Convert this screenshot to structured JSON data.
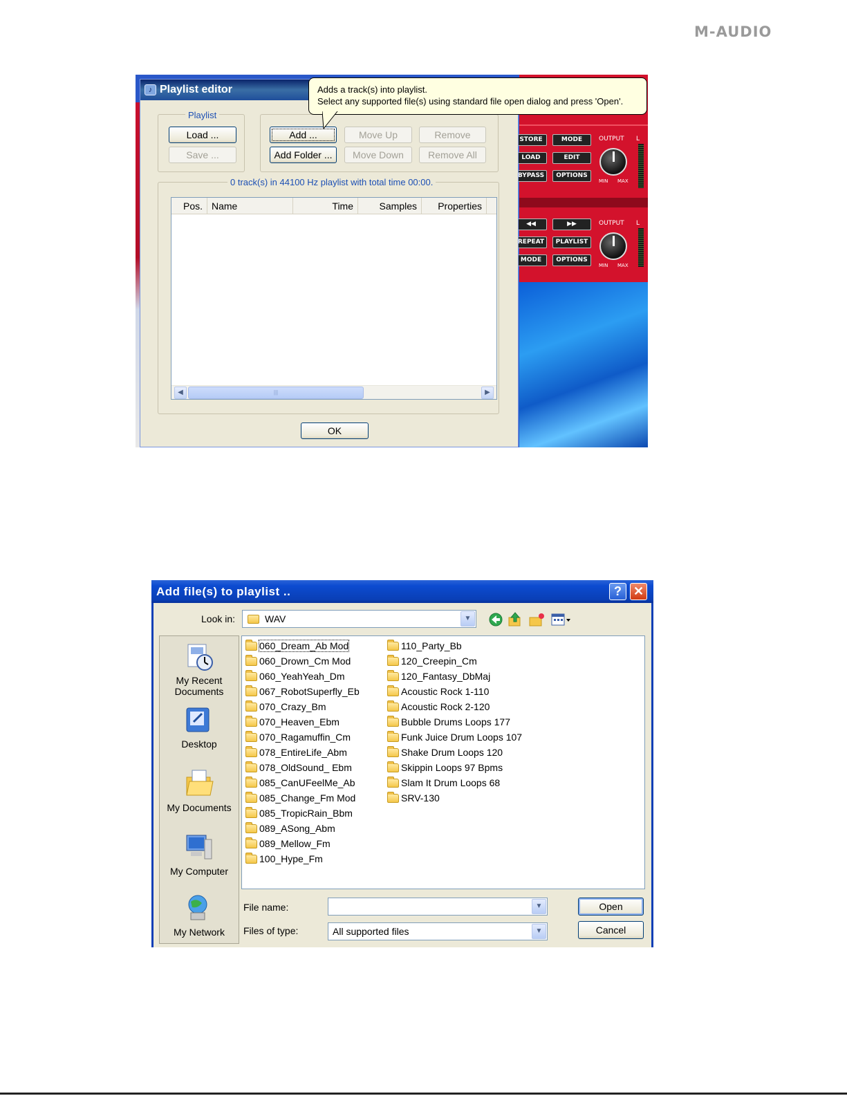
{
  "brand": {
    "logo_text": "M-AUDIO"
  },
  "playlist_editor": {
    "title": "Playlist editor",
    "playlist_group_label": "Playlist",
    "load_label": "Load ...",
    "save_label": "Save ...",
    "add_label": "Add ...",
    "add_folder_label": "Add Folder ...",
    "move_up_label": "Move Up",
    "move_down_label": "Move Down",
    "remove_label": "Remove",
    "remove_all_label": "Remove All",
    "summary": "0 track(s) in 44100 Hz playlist with total time 00:00.",
    "columns": [
      "Pos.",
      "Name",
      "Time",
      "Samples",
      "Properties"
    ],
    "ok_label": "OK",
    "tooltip_line1": "Adds a track(s) into playlist.",
    "tooltip_line2": "Select any supported file(s) using standard file open dialog and press 'Open'."
  },
  "device_panel": {
    "top": {
      "buttons": [
        "STORE",
        "MODE",
        "LOAD",
        "EDIT",
        "BYPASS",
        "OPTIONS"
      ],
      "output_label": "OUTPUT",
      "min_label": "MIN",
      "max_label": "MAX",
      "channel_label": "L"
    },
    "bottom": {
      "buttons": [
        "◀◀",
        "▶▶",
        "REPEAT",
        "PLAYLIST",
        "MODE",
        "OPTIONS"
      ],
      "output_label": "OUTPUT",
      "min_label": "MIN",
      "max_label": "MAX",
      "channel_label": "L"
    }
  },
  "open_dialog": {
    "title": "Add file(s) to playlist ..",
    "look_in_label": "Look in:",
    "look_in_value": "WAV",
    "places": [
      "My Recent Documents",
      "Desktop",
      "My Documents",
      "My Computer",
      "My Network"
    ],
    "folders_col1": [
      "060_Dream_Ab Mod",
      "060_Drown_Cm Mod",
      "060_YeahYeah_Dm",
      "067_RobotSuperfly_Eb",
      "070_Crazy_Bm",
      "070_Heaven_Ebm",
      "070_Ragamuffin_Cm",
      "078_EntireLife_Abm",
      "078_OldSound_ Ebm",
      "085_CanUFeelMe_Ab",
      "085_Change_Fm Mod",
      "085_TropicRain_Bbm",
      "089_ASong_Abm",
      "089_Mellow_Fm",
      "100_Hype_Fm"
    ],
    "folders_col2": [
      "110_Party_Bb",
      "120_Creepin_Cm",
      "120_Fantasy_DbMaj",
      "Acoustic Rock 1-110",
      "Acoustic Rock 2-120",
      "Bubble Drums Loops 177",
      "Funk Juice Drum Loops 107",
      "Shake Drum Loops 120",
      "Skippin Loops 97 Bpms",
      "Slam It Drum Loops 68",
      "SRV-130"
    ],
    "file_name_label": "File name:",
    "file_name_value": "",
    "files_of_type_label": "Files of type:",
    "files_of_type_value": "All supported files",
    "open_label": "Open",
    "cancel_label": "Cancel"
  }
}
